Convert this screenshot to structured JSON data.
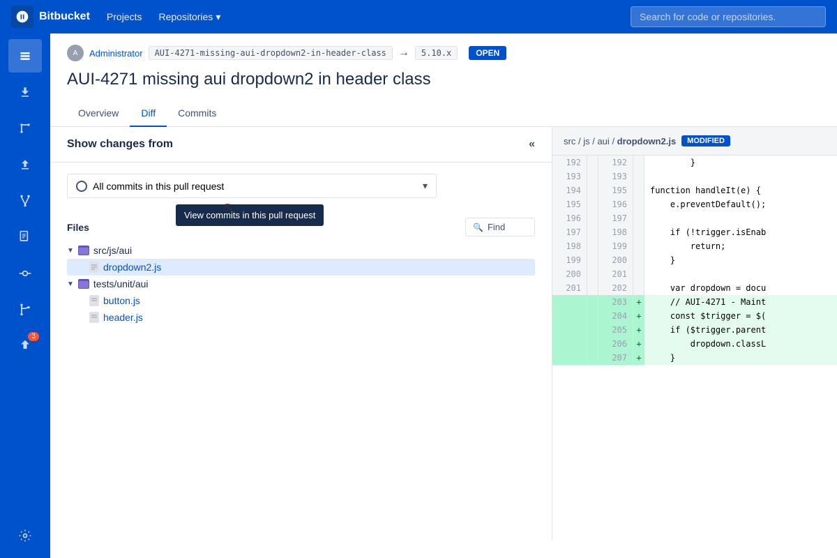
{
  "topnav": {
    "logo": "Bitbucket",
    "projects_label": "Projects",
    "repositories_label": "Repositories",
    "search_placeholder": "Search for code or repositories."
  },
  "sidebar": {
    "items": [
      {
        "name": "home",
        "icon": "</>",
        "active": true
      },
      {
        "name": "download",
        "icon": "⬇"
      },
      {
        "name": "source",
        "icon": "⑂"
      },
      {
        "name": "push",
        "icon": "⬆"
      },
      {
        "name": "fork",
        "icon": "⑂"
      },
      {
        "name": "snippets",
        "icon": "📄"
      },
      {
        "name": "commits",
        "icon": "◎"
      },
      {
        "name": "branch",
        "icon": "⑂"
      },
      {
        "name": "deploy",
        "icon": "⬆",
        "badge": "3"
      }
    ],
    "settings_icon": "⚙"
  },
  "pr": {
    "author": "Administrator",
    "source_branch": "AUI-4271-missing-aui-dropdown2-in-header-class",
    "target_branch": "5.10.x",
    "status": "OPEN",
    "title": "AUI-4271 missing aui dropdown2 in header class",
    "tabs": [
      {
        "label": "Overview",
        "active": false
      },
      {
        "label": "Diff",
        "active": true
      },
      {
        "label": "Commits",
        "active": false
      }
    ]
  },
  "diff_panel": {
    "show_changes_title": "Show changes from",
    "collapse_icon": "«",
    "commits_dropdown_label": "All commits in this pull request",
    "tooltip": "View commits in this pull request",
    "files_title": "Files",
    "find_placeholder": "Find",
    "file_tree": {
      "folders": [
        {
          "name": "src/js/aui",
          "files": [
            {
              "name": "dropdown2.js",
              "selected": true
            }
          ]
        },
        {
          "name": "tests/unit/aui",
          "files": [
            {
              "name": "button.js",
              "selected": false
            },
            {
              "name": "header.js",
              "selected": false
            }
          ]
        }
      ]
    }
  },
  "diff_viewer": {
    "file_path_parts": [
      "src",
      "js",
      "aui"
    ],
    "file_name": "dropdown2.js",
    "file_status": "MODIFIED",
    "lines": [
      {
        "left_num": "192",
        "right_num": "192",
        "content": "        }",
        "type": "normal"
      },
      {
        "left_num": "193",
        "right_num": "193",
        "content": "",
        "type": "normal"
      },
      {
        "left_num": "194",
        "right_num": "195",
        "content": "function handleIt(e) {",
        "type": "normal"
      },
      {
        "left_num": "195",
        "right_num": "196",
        "content": "    e.preventDefault();",
        "type": "normal"
      },
      {
        "left_num": "196",
        "right_num": "197",
        "content": "",
        "type": "normal"
      },
      {
        "left_num": "197",
        "right_num": "198",
        "content": "    if (!trigger.isEnab",
        "type": "normal"
      },
      {
        "left_num": "198",
        "right_num": "199",
        "content": "        return;",
        "type": "normal"
      },
      {
        "left_num": "199",
        "right_num": "200",
        "content": "    }",
        "type": "normal"
      },
      {
        "left_num": "200",
        "right_num": "201",
        "content": "",
        "type": "normal"
      },
      {
        "left_num": "201",
        "right_num": "202",
        "content": "    var dropdown = docu",
        "type": "normal"
      },
      {
        "left_num": "",
        "right_num": "203",
        "content": "    // AUI-4271 - Maint",
        "type": "added"
      },
      {
        "left_num": "",
        "right_num": "204",
        "content": "    const $trigger = $(",
        "type": "added"
      },
      {
        "left_num": "",
        "right_num": "205",
        "content": "    if ($trigger.parent",
        "type": "added"
      },
      {
        "left_num": "",
        "right_num": "206",
        "content": "        dropdown.classL",
        "type": "added"
      },
      {
        "left_num": "",
        "right_num": "207",
        "content": "    }",
        "type": "added"
      }
    ]
  }
}
